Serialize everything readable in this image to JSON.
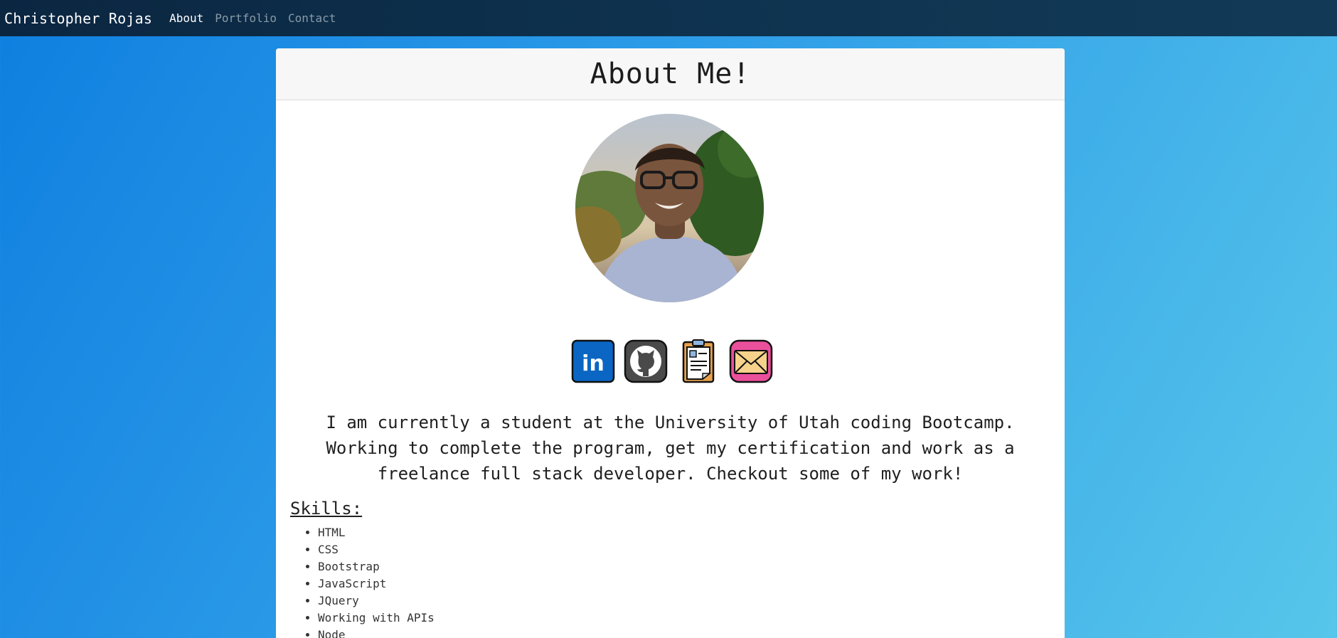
{
  "navbar": {
    "brand": "Christopher Rojas",
    "links": [
      {
        "label": "About",
        "active": true
      },
      {
        "label": "Portfolio",
        "active": false
      },
      {
        "label": "Contact",
        "active": false
      }
    ]
  },
  "card": {
    "title": "About Me!",
    "bio": "I am currently a student at the University of Utah coding Bootcamp. Working to complete the program, get my certification and work as a freelance full stack developer. Checkout some of my work!",
    "skills_heading": "Skills:",
    "skills": [
      "HTML",
      "CSS",
      "Bootstrap",
      "JavaScript",
      "JQuery",
      "Working with APIs",
      "Node"
    ]
  },
  "social": [
    {
      "icon": "linkedin-icon",
      "text": "in"
    },
    {
      "icon": "github-icon"
    },
    {
      "icon": "resume-icon"
    },
    {
      "icon": "email-icon"
    }
  ],
  "colors": {
    "linkedin": "#0a66c2",
    "github": "#4a4a4a",
    "resume": "#e8a14a",
    "email": "#ea4f9c",
    "envelope": "#f6d28a"
  }
}
